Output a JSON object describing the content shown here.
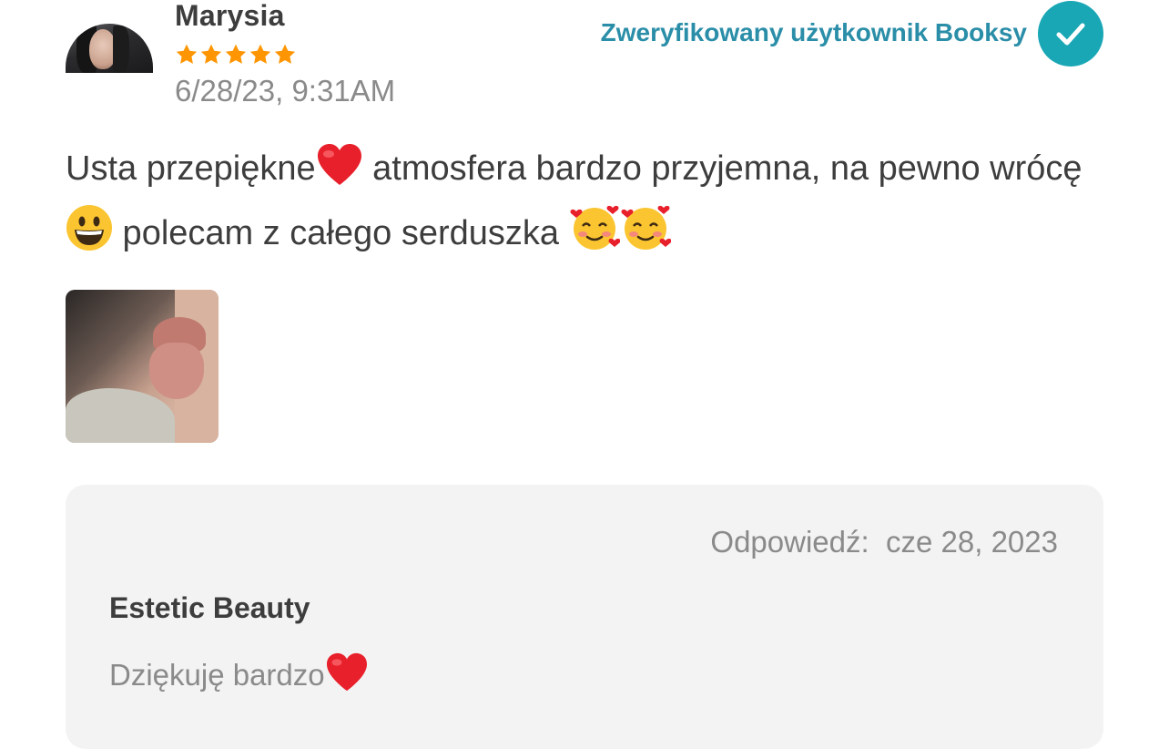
{
  "review": {
    "author_name": "Marysia",
    "rating": 5,
    "date": "6/28/23, 9:31AM",
    "verified_label": "Zweryfikowany użytkownik Booksy",
    "text_part1": "Usta przepiękne",
    "text_part2": " atmosfera bardzo przyjemna, na pewno wrócę ",
    "text_part3": " polecam z całego serduszka ",
    "emojis": [
      "red-heart",
      "grinning-face",
      "smiling-face-with-hearts",
      "smiling-face-with-hearts"
    ]
  },
  "reply": {
    "date_label": "Odpowiedź:",
    "date_value": "cze 28, 2023",
    "author": "Estetic Beauty",
    "text": "Dziękuję bardzo"
  },
  "colors": {
    "star": "#ff9500",
    "verified_text": "#2b8ea8",
    "check_badge": "#19a7b5",
    "reply_background": "#f3f3f3"
  }
}
